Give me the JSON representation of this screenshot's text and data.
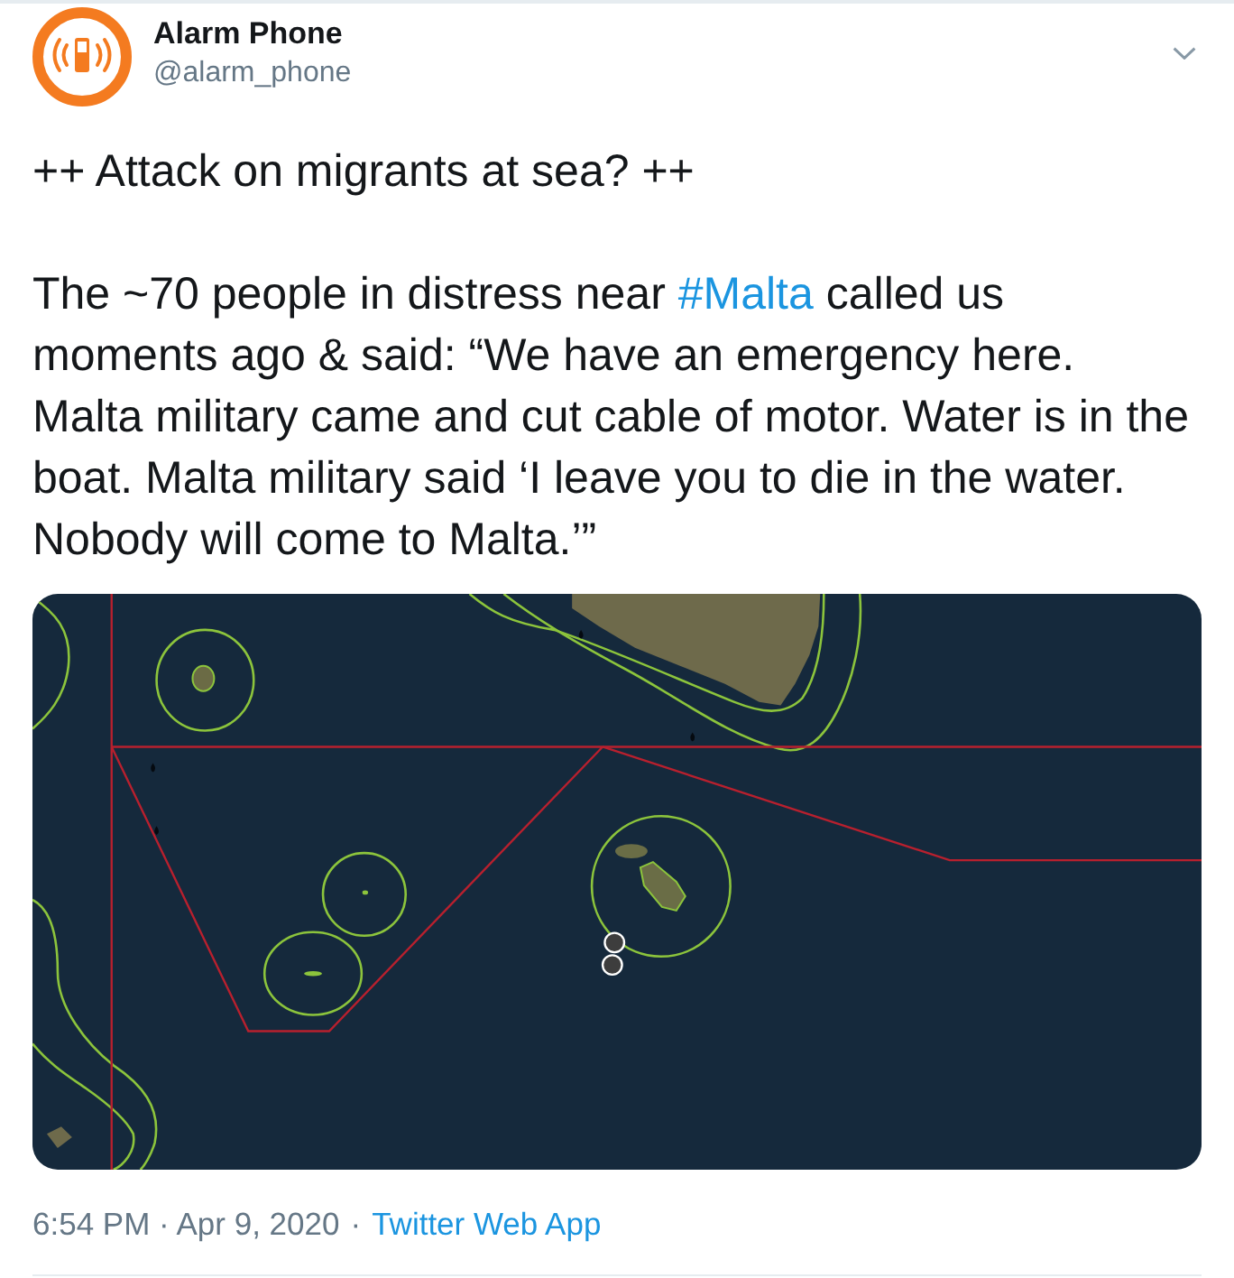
{
  "author": {
    "name": "Alarm Phone",
    "handle": "@alarm_phone"
  },
  "tweet": {
    "segments": [
      {
        "kind": "text",
        "text": "++ Attack on migrants at sea? ++\n\nThe ~70 people in distress near "
      },
      {
        "kind": "hashtag",
        "text": "#Malta"
      },
      {
        "kind": "text",
        "text": " called us\nmoments ago & said: “We have an emergency here.\nMalta military came and cut cable of motor. Water is in the\nboat. Malta military said ‘I leave you to die in the water.\nNobody will come to Malta.’”"
      }
    ]
  },
  "footer": {
    "timestamp": "6:54 PM · Apr 9, 2020",
    "separator": "·",
    "source": "Twitter Web App"
  }
}
